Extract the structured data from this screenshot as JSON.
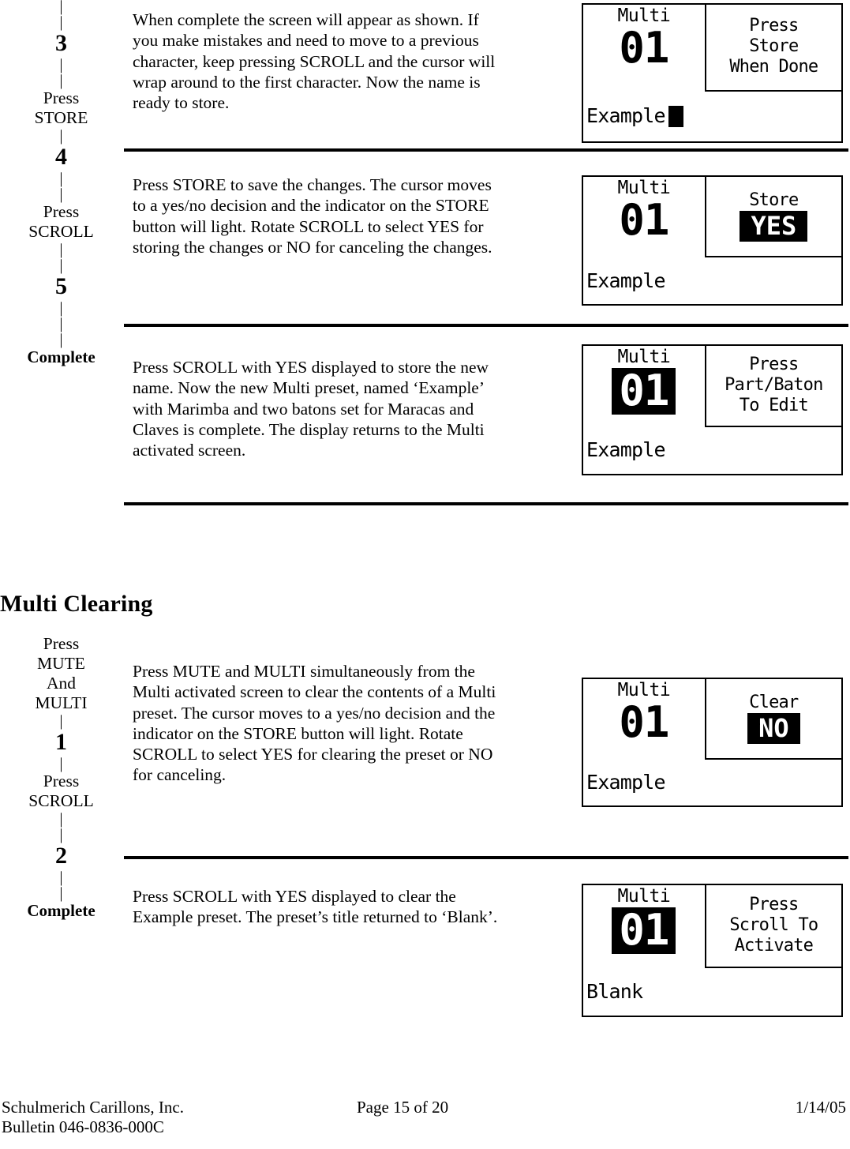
{
  "page": {
    "section_heading": "Multi Clearing"
  },
  "steps_top": [
    {
      "kind": "tick",
      "text": "|"
    },
    {
      "kind": "tick",
      "text": "|"
    },
    {
      "kind": "num",
      "text": "3"
    },
    {
      "kind": "tick",
      "text": "|"
    },
    {
      "kind": "tick",
      "text": "|"
    },
    {
      "kind": "label",
      "text": "Press"
    },
    {
      "kind": "label",
      "text": "STORE"
    },
    {
      "kind": "tick",
      "text": "|"
    },
    {
      "kind": "num",
      "text": "4"
    },
    {
      "kind": "tick",
      "text": "|"
    },
    {
      "kind": "tick",
      "text": "|"
    },
    {
      "kind": "label",
      "text": "Press"
    },
    {
      "kind": "label",
      "text": "SCROLL"
    },
    {
      "kind": "tick",
      "text": "|"
    },
    {
      "kind": "tick",
      "text": "|"
    },
    {
      "kind": "num",
      "text": "5"
    },
    {
      "kind": "tick",
      "text": "|"
    },
    {
      "kind": "tick",
      "text": "|"
    },
    {
      "kind": "tick",
      "text": "|"
    },
    {
      "kind": "label_bold",
      "text": "Complete"
    }
  ],
  "steps_bottom": [
    {
      "kind": "label",
      "text": "Press"
    },
    {
      "kind": "label",
      "text": "MUTE"
    },
    {
      "kind": "label",
      "text": "And"
    },
    {
      "kind": "label",
      "text": "MULTI"
    },
    {
      "kind": "tick",
      "text": "|"
    },
    {
      "kind": "num",
      "text": "1"
    },
    {
      "kind": "tick",
      "text": "|"
    },
    {
      "kind": "label",
      "text": "Press"
    },
    {
      "kind": "label",
      "text": "SCROLL"
    },
    {
      "kind": "tick",
      "text": "|"
    },
    {
      "kind": "tick",
      "text": "|"
    },
    {
      "kind": "num",
      "text": "2"
    },
    {
      "kind": "tick",
      "text": "|"
    },
    {
      "kind": "tick",
      "text": "|"
    },
    {
      "kind": "label_bold",
      "text": "Complete"
    }
  ],
  "paragraphs": {
    "step3": "When complete the screen will appear as shown.  If you make mistakes and need to move to a previous character, keep pressing SCROLL and the cursor will wrap around to the first character.  Now the name is ready to store.",
    "step4": "Press STORE to save the changes. The cursor moves to a yes/no decision and the indicator on the STORE button will light.  Rotate SCROLL to select YES for storing the changes or NO for canceling the changes.",
    "step5": "Press SCROLL with YES displayed to store the new name.  Now the new Multi preset, named ‘Example’ with Marimba and two batons set for Maracas and Claves is complete.    The display returns to the Multi activated screen.",
    "clear1": "Press MUTE and MULTI simultaneously from the Multi activated screen to clear the contents of a Multi preset.  The cursor moves to a yes/no decision and the indicator on the STORE button will light.  Rotate SCROLL to select YES for clearing the preset or NO for canceling.",
    "clear2": "Press SCROLL with YES displayed to clear the Example preset.  The preset’s title returned to ‘Blank’."
  },
  "displays": [
    {
      "id": "lcd-store-when-done",
      "title": "Multi",
      "number": "01",
      "number_inverted": false,
      "right_lines": [
        "Press",
        "Store",
        "When Done"
      ],
      "right_inverted": false,
      "right_big": false,
      "name": "Example",
      "cursor": true
    },
    {
      "id": "lcd-store-yes",
      "title": "Multi",
      "number": "01",
      "number_inverted": false,
      "right_lines": [
        "Store",
        "YES"
      ],
      "right_inverted": true,
      "right_big": true,
      "name": "Example",
      "cursor": false
    },
    {
      "id": "lcd-press-part-baton",
      "title": "Multi",
      "number": "01",
      "number_inverted": true,
      "right_lines": [
        "Press",
        "Part/Baton",
        "To Edit"
      ],
      "right_inverted": false,
      "right_big": false,
      "name": "Example",
      "cursor": false
    },
    {
      "id": "lcd-clear-no",
      "title": "Multi",
      "number": "01",
      "number_inverted": false,
      "right_lines": [
        "Clear",
        "NO"
      ],
      "right_inverted": true,
      "right_big": true,
      "name": "Example",
      "cursor": false
    },
    {
      "id": "lcd-press-scroll-activate",
      "title": "Multi",
      "number": "01",
      "number_inverted": true,
      "right_lines": [
        "Press",
        "Scroll To",
        "Activate"
      ],
      "right_inverted": false,
      "right_big": false,
      "name": "Blank",
      "cursor": false
    }
  ],
  "footer": {
    "company": "Schulmerich Carillons, Inc.",
    "page": "Page 15 of 20",
    "date": "1/14/05",
    "bulletin": "Bulletin 046-0836-000C"
  },
  "colors": {
    "ink": "#000000",
    "paper": "#ffffff"
  }
}
